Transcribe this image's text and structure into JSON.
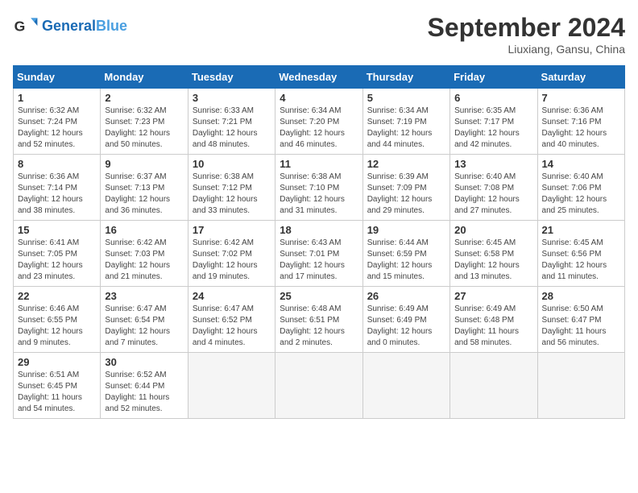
{
  "header": {
    "logo_general": "General",
    "logo_blue": "Blue",
    "month": "September 2024",
    "location": "Liuxiang, Gansu, China"
  },
  "weekdays": [
    "Sunday",
    "Monday",
    "Tuesday",
    "Wednesday",
    "Thursday",
    "Friday",
    "Saturday"
  ],
  "weeks": [
    [
      {
        "day": "1",
        "sunrise": "6:32 AM",
        "sunset": "7:24 PM",
        "daylight": "12 hours and 52 minutes."
      },
      {
        "day": "2",
        "sunrise": "6:32 AM",
        "sunset": "7:23 PM",
        "daylight": "12 hours and 50 minutes."
      },
      {
        "day": "3",
        "sunrise": "6:33 AM",
        "sunset": "7:21 PM",
        "daylight": "12 hours and 48 minutes."
      },
      {
        "day": "4",
        "sunrise": "6:34 AM",
        "sunset": "7:20 PM",
        "daylight": "12 hours and 46 minutes."
      },
      {
        "day": "5",
        "sunrise": "6:34 AM",
        "sunset": "7:19 PM",
        "daylight": "12 hours and 44 minutes."
      },
      {
        "day": "6",
        "sunrise": "6:35 AM",
        "sunset": "7:17 PM",
        "daylight": "12 hours and 42 minutes."
      },
      {
        "day": "7",
        "sunrise": "6:36 AM",
        "sunset": "7:16 PM",
        "daylight": "12 hours and 40 minutes."
      }
    ],
    [
      {
        "day": "8",
        "sunrise": "6:36 AM",
        "sunset": "7:14 PM",
        "daylight": "12 hours and 38 minutes."
      },
      {
        "day": "9",
        "sunrise": "6:37 AM",
        "sunset": "7:13 PM",
        "daylight": "12 hours and 36 minutes."
      },
      {
        "day": "10",
        "sunrise": "6:38 AM",
        "sunset": "7:12 PM",
        "daylight": "12 hours and 33 minutes."
      },
      {
        "day": "11",
        "sunrise": "6:38 AM",
        "sunset": "7:10 PM",
        "daylight": "12 hours and 31 minutes."
      },
      {
        "day": "12",
        "sunrise": "6:39 AM",
        "sunset": "7:09 PM",
        "daylight": "12 hours and 29 minutes."
      },
      {
        "day": "13",
        "sunrise": "6:40 AM",
        "sunset": "7:08 PM",
        "daylight": "12 hours and 27 minutes."
      },
      {
        "day": "14",
        "sunrise": "6:40 AM",
        "sunset": "7:06 PM",
        "daylight": "12 hours and 25 minutes."
      }
    ],
    [
      {
        "day": "15",
        "sunrise": "6:41 AM",
        "sunset": "7:05 PM",
        "daylight": "12 hours and 23 minutes."
      },
      {
        "day": "16",
        "sunrise": "6:42 AM",
        "sunset": "7:03 PM",
        "daylight": "12 hours and 21 minutes."
      },
      {
        "day": "17",
        "sunrise": "6:42 AM",
        "sunset": "7:02 PM",
        "daylight": "12 hours and 19 minutes."
      },
      {
        "day": "18",
        "sunrise": "6:43 AM",
        "sunset": "7:01 PM",
        "daylight": "12 hours and 17 minutes."
      },
      {
        "day": "19",
        "sunrise": "6:44 AM",
        "sunset": "6:59 PM",
        "daylight": "12 hours and 15 minutes."
      },
      {
        "day": "20",
        "sunrise": "6:45 AM",
        "sunset": "6:58 PM",
        "daylight": "12 hours and 13 minutes."
      },
      {
        "day": "21",
        "sunrise": "6:45 AM",
        "sunset": "6:56 PM",
        "daylight": "12 hours and 11 minutes."
      }
    ],
    [
      {
        "day": "22",
        "sunrise": "6:46 AM",
        "sunset": "6:55 PM",
        "daylight": "12 hours and 9 minutes."
      },
      {
        "day": "23",
        "sunrise": "6:47 AM",
        "sunset": "6:54 PM",
        "daylight": "12 hours and 7 minutes."
      },
      {
        "day": "24",
        "sunrise": "6:47 AM",
        "sunset": "6:52 PM",
        "daylight": "12 hours and 4 minutes."
      },
      {
        "day": "25",
        "sunrise": "6:48 AM",
        "sunset": "6:51 PM",
        "daylight": "12 hours and 2 minutes."
      },
      {
        "day": "26",
        "sunrise": "6:49 AM",
        "sunset": "6:49 PM",
        "daylight": "12 hours and 0 minutes."
      },
      {
        "day": "27",
        "sunrise": "6:49 AM",
        "sunset": "6:48 PM",
        "daylight": "11 hours and 58 minutes."
      },
      {
        "day": "28",
        "sunrise": "6:50 AM",
        "sunset": "6:47 PM",
        "daylight": "11 hours and 56 minutes."
      }
    ],
    [
      {
        "day": "29",
        "sunrise": "6:51 AM",
        "sunset": "6:45 PM",
        "daylight": "11 hours and 54 minutes."
      },
      {
        "day": "30",
        "sunrise": "6:52 AM",
        "sunset": "6:44 PM",
        "daylight": "11 hours and 52 minutes."
      },
      null,
      null,
      null,
      null,
      null
    ]
  ]
}
